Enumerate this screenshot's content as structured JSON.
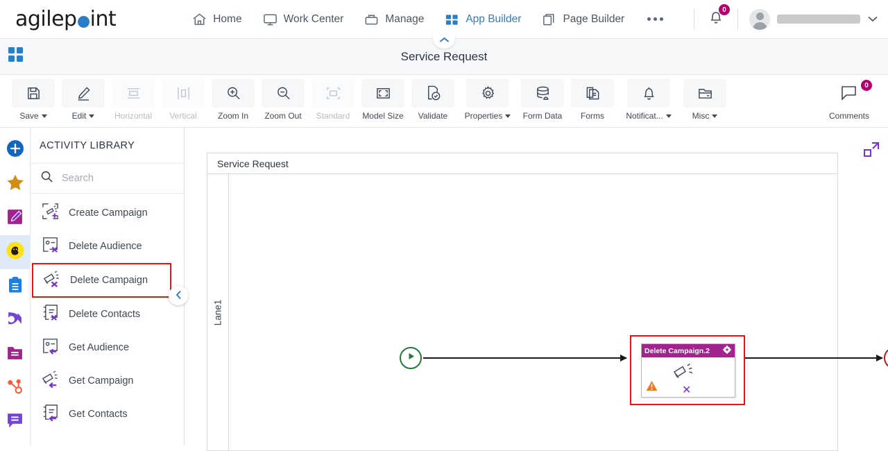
{
  "app": {
    "brand_prefix": "agilep",
    "brand_suffix": "int",
    "accent_blue": "#2a7ec9",
    "accent_magenta": "#b4006e",
    "highlight_red": "#e8150f",
    "node_header_color": "#a3238e"
  },
  "topnav": {
    "items": [
      {
        "label": "Home",
        "icon": "home-icon",
        "active": false
      },
      {
        "label": "Work Center",
        "icon": "monitor-icon",
        "active": false
      },
      {
        "label": "Manage",
        "icon": "briefcase-icon",
        "active": false
      },
      {
        "label": "App Builder",
        "icon": "grid-icon",
        "active": true
      },
      {
        "label": "Page Builder",
        "icon": "pages-icon",
        "active": false
      }
    ],
    "more_label": "•••",
    "notification_count": "0",
    "user_name": ""
  },
  "titlebar": {
    "title": "Service Request",
    "collapse_icon": "chevron-up-icon",
    "apps_icon": "apps-grid-icon"
  },
  "toolbar": {
    "buttons": [
      {
        "label": "Save",
        "icon": "save-icon",
        "dropdown": true,
        "disabled": false
      },
      {
        "label": "Edit",
        "icon": "pencil-icon",
        "dropdown": true,
        "disabled": false
      },
      {
        "label": "Horizontal",
        "icon": "horizontal-align-icon",
        "dropdown": false,
        "disabled": true
      },
      {
        "label": "Vertical",
        "icon": "vertical-align-icon",
        "dropdown": false,
        "disabled": true
      },
      {
        "label": "Zoom In",
        "icon": "zoom-in-icon",
        "dropdown": false,
        "disabled": false
      },
      {
        "label": "Zoom Out",
        "icon": "zoom-out-icon",
        "dropdown": false,
        "disabled": false
      },
      {
        "label": "Standard",
        "icon": "standard-size-icon",
        "dropdown": false,
        "disabled": true
      },
      {
        "label": "Model Size",
        "icon": "model-size-icon",
        "dropdown": false,
        "disabled": false
      },
      {
        "label": "Validate",
        "icon": "validate-icon",
        "dropdown": false,
        "disabled": false
      },
      {
        "label": "Properties",
        "icon": "gear-icon",
        "dropdown": true,
        "disabled": false
      },
      {
        "label": "Form Data",
        "icon": "database-icon",
        "dropdown": false,
        "disabled": false
      },
      {
        "label": "Forms",
        "icon": "forms-icon",
        "dropdown": false,
        "disabled": false
      },
      {
        "label": "Notificat...",
        "icon": "bell-icon",
        "dropdown": true,
        "disabled": false
      },
      {
        "label": "Misc",
        "icon": "folder-minus-icon",
        "dropdown": true,
        "disabled": false
      }
    ],
    "comments": {
      "label": "Comments",
      "icon": "comment-icon",
      "count": "0"
    }
  },
  "rail": {
    "items": [
      {
        "name": "add-icon",
        "selected": false
      },
      {
        "name": "favorites-star-icon",
        "selected": false
      },
      {
        "name": "custom-activity-icon",
        "selected": false
      },
      {
        "name": "mailchimp-icon",
        "selected": true
      },
      {
        "name": "clipboard-icon",
        "selected": false
      },
      {
        "name": "activecampaign-icon",
        "selected": false
      },
      {
        "name": "folder-icon",
        "selected": false
      },
      {
        "name": "hubspot-icon",
        "selected": false
      },
      {
        "name": "chat-icon",
        "selected": false
      }
    ]
  },
  "panel": {
    "title": "ACTIVITY LIBRARY",
    "search": {
      "placeholder": "Search",
      "value": ""
    },
    "collapse_icon": "chevron-left-icon",
    "activities": [
      {
        "label": "Create Campaign",
        "icon": "create-campaign-icon",
        "highlighted": false
      },
      {
        "label": "Delete Audience",
        "icon": "delete-audience-icon",
        "highlighted": false
      },
      {
        "label": "Delete Campaign",
        "icon": "delete-campaign-icon",
        "highlighted": true
      },
      {
        "label": "Delete Contacts",
        "icon": "delete-contacts-icon",
        "highlighted": false
      },
      {
        "label": "Get Audience",
        "icon": "get-audience-icon",
        "highlighted": false
      },
      {
        "label": "Get Campaign",
        "icon": "get-campaign-icon",
        "highlighted": false
      },
      {
        "label": "Get Contacts",
        "icon": "get-contacts-icon",
        "highlighted": false
      }
    ]
  },
  "canvas": {
    "pool_title": "Service Request",
    "lane_label": "Lane1",
    "expand_icon": "expand-icon",
    "start_event": {
      "name": "start-event",
      "icon": "play-icon"
    },
    "end_event": {
      "name": "end-event",
      "icon": "stop-icon"
    },
    "task": {
      "title": "Delete Campaign.2",
      "gear_icon": "gear-icon",
      "body_icon": "megaphone-icon",
      "warning_icon": "warning-triangle-icon",
      "delete_icon": "x-mark-icon",
      "highlighted": true
    }
  }
}
